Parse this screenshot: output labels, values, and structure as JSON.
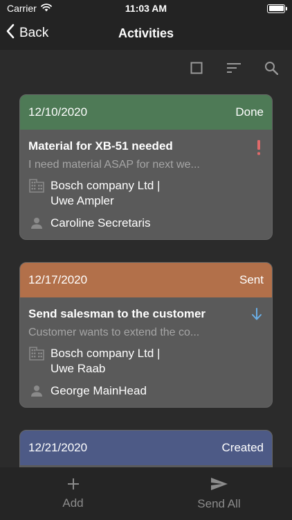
{
  "status_bar": {
    "carrier": "Carrier",
    "time": "11:03 AM"
  },
  "nav": {
    "back_label": "Back",
    "title": "Activities"
  },
  "toolbar": {
    "icons": [
      "select-square-icon",
      "sort-icon",
      "search-icon"
    ]
  },
  "activities": [
    {
      "date": "12/10/2020",
      "status": "Done",
      "header_color": "#4e7a56",
      "title": "Material for XB-51 needed",
      "description": "I need material ASAP for next we...",
      "company": "Bosch company Ltd |",
      "contact": "Uwe Ampler",
      "assignee": "Caroline Secretaris",
      "priority_icon": "exclamation-icon",
      "priority_color": "#e06a6a"
    },
    {
      "date": "12/17/2020",
      "status": "Sent",
      "header_color": "#b2704a",
      "title": "Send salesman to the customer",
      "description": "Customer wants to extend the co...",
      "company": "Bosch company Ltd |",
      "contact": "Uwe Raab",
      "assignee": "George MainHead",
      "priority_icon": "arrow-down-icon",
      "priority_color": "#6aaee6"
    },
    {
      "date": "12/21/2020",
      "status": "Created",
      "header_color": "#4d5a86"
    }
  ],
  "bottom_bar": {
    "add_label": "Add",
    "send_all_label": "Send All"
  }
}
